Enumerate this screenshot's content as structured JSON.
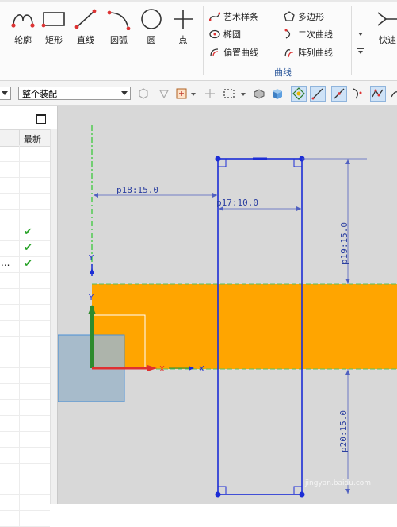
{
  "ribbon": {
    "big_buttons": [
      {
        "label": "轮廓",
        "icon": "profile-icon"
      },
      {
        "label": "矩形",
        "icon": "rectangle-icon"
      },
      {
        "label": "直线",
        "icon": "line-icon"
      },
      {
        "label": "圆弧",
        "icon": "arc-icon"
      },
      {
        "label": "圆",
        "icon": "circle-icon"
      },
      {
        "label": "点",
        "icon": "point-icon"
      }
    ],
    "curve_items": [
      {
        "label": "艺术样条",
        "icon": "studio-spline-icon"
      },
      {
        "label": "多边形",
        "icon": "polygon-icon"
      },
      {
        "label": "椭圆",
        "icon": "ellipse-icon"
      },
      {
        "label": "二次曲线",
        "icon": "conic-icon"
      },
      {
        "label": "偏置曲线",
        "icon": "offset-curve-icon"
      },
      {
        "label": "阵列曲线",
        "icon": "pattern-curve-icon"
      }
    ],
    "group_label": "曲线",
    "right_button": {
      "label": "快速",
      "icon": "quick-trim-icon"
    }
  },
  "toolbar": {
    "assembly_filter": "整个装配"
  },
  "navigator": {
    "column_header": "最新",
    "rows": [
      {
        "check": false,
        "label": ""
      },
      {
        "check": false,
        "label": ""
      },
      {
        "check": false,
        "label": ""
      },
      {
        "check": false,
        "label": ""
      },
      {
        "check": false,
        "label": ""
      },
      {
        "check": true,
        "label": ""
      },
      {
        "check": true,
        "label": ""
      },
      {
        "check": true,
        "label": "..."
      },
      {
        "check": false,
        "label": ""
      },
      {
        "check": false,
        "label": ""
      },
      {
        "check": false,
        "label": ""
      },
      {
        "check": false,
        "label": ""
      },
      {
        "check": false,
        "label": ""
      },
      {
        "check": false,
        "label": ""
      },
      {
        "check": false,
        "label": ""
      },
      {
        "check": false,
        "label": ""
      },
      {
        "check": false,
        "label": ""
      },
      {
        "check": false,
        "label": ""
      },
      {
        "check": false,
        "label": ""
      },
      {
        "check": false,
        "label": ""
      },
      {
        "check": false,
        "label": ""
      },
      {
        "check": false,
        "label": ""
      },
      {
        "check": false,
        "label": ""
      },
      {
        "check": false,
        "label": ""
      }
    ]
  },
  "sketch": {
    "dimensions": {
      "p18": "p18:15.0",
      "p17": "p17:10.0",
      "p19": "p19:15.0",
      "p20": "p20:15.0"
    },
    "axis_labels": {
      "x": "X",
      "y": "Y",
      "y2": "Y",
      "x2": "X"
    },
    "colors": {
      "band": "#FFA500",
      "sketch": "#1C2DD6",
      "dimension": "#2A3EA0",
      "canvas": "#D8D8D8",
      "y_axis": "#2E8B2E",
      "x_axis": "#E03030"
    }
  },
  "watermark": "jingyan.baidu.com"
}
